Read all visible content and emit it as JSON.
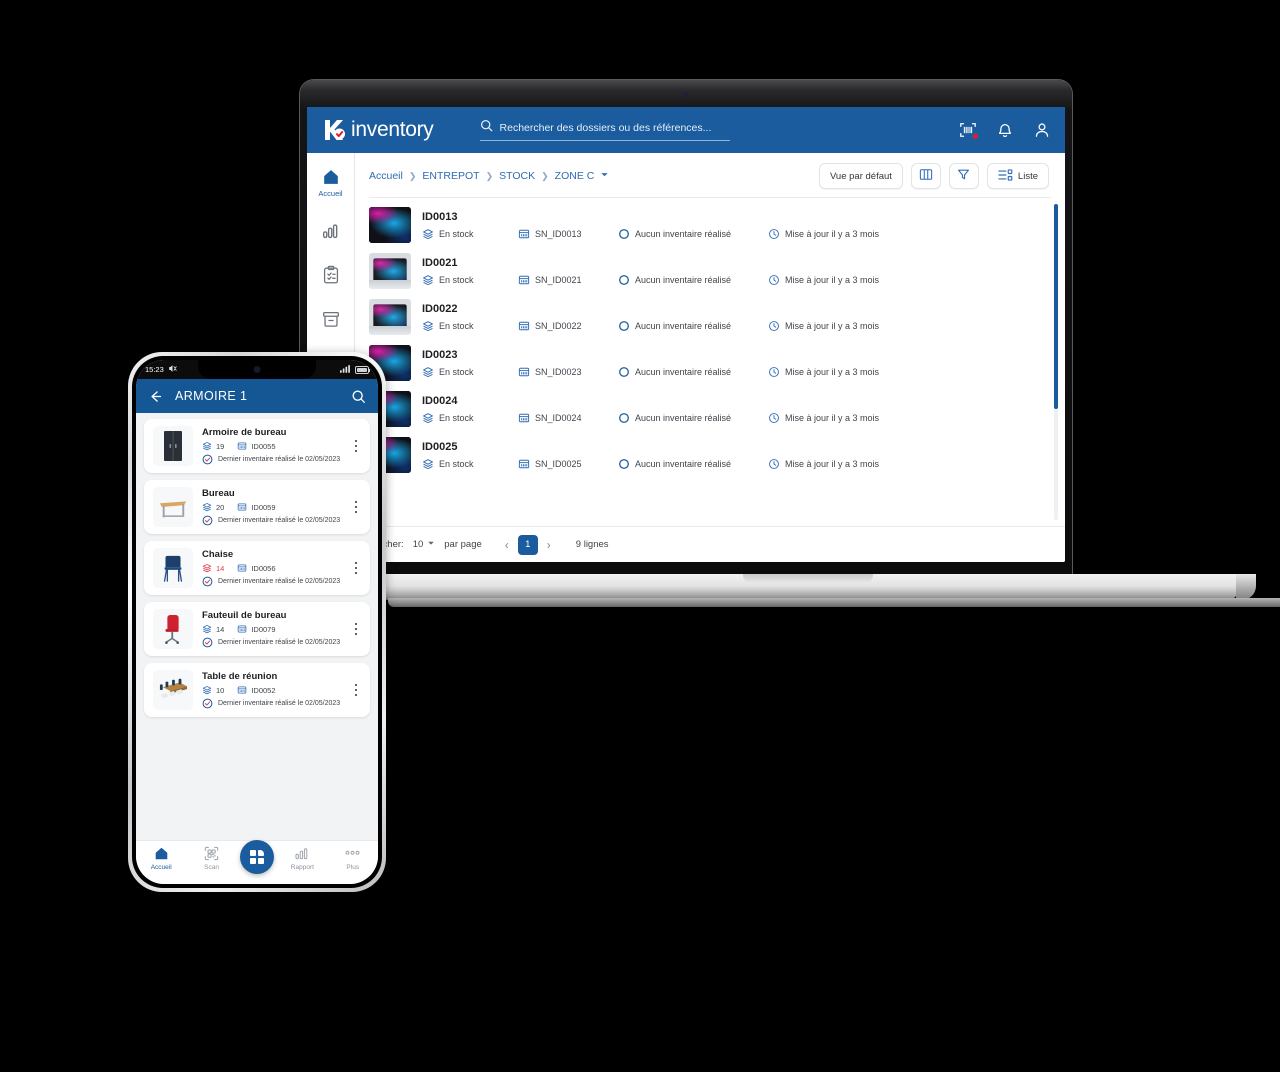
{
  "desktop": {
    "brand": {
      "logo_icon": "k-check-logo",
      "name": "inventory"
    },
    "search": {
      "icon": "search-icon",
      "placeholder": "Rechercher des dossiers ou des références..."
    },
    "header_icons": [
      {
        "name": "barcode-scan-icon",
        "badge": true
      },
      {
        "name": "bell-icon",
        "badge": false
      },
      {
        "name": "user-icon",
        "badge": false
      }
    ],
    "sidebar": [
      {
        "icon": "home-icon",
        "label": "Accueil",
        "active": true
      },
      {
        "icon": "bar-chart-icon",
        "label": "",
        "active": false
      },
      {
        "icon": "clipboard-check-icon",
        "label": "",
        "active": false
      },
      {
        "icon": "archive-box-icon",
        "label": "",
        "active": false
      }
    ],
    "breadcrumb": [
      "Accueil",
      "ENTREPOT",
      "STOCK",
      "ZONE C"
    ],
    "toolbar": {
      "view_label": "Vue par défaut",
      "columns_icon": "columns-icon",
      "filter_icon": "filter-funnel-icon",
      "list_label": "Liste",
      "list_icon": "list-view-icon"
    },
    "rows": [
      {
        "id": "ID0013",
        "status": "En stock",
        "serial": "SN_ID0013",
        "inventory": "Aucun inventaire réalisé",
        "updated": "Mise à jour il y a 3 mois",
        "thumb": "dark"
      },
      {
        "id": "ID0021",
        "status": "En stock",
        "serial": "SN_ID0021",
        "inventory": "Aucun inventaire réalisé",
        "updated": "Mise à jour il y a 3 mois",
        "thumb": "light"
      },
      {
        "id": "ID0022",
        "status": "En stock",
        "serial": "SN_ID0022",
        "inventory": "Aucun inventaire réalisé",
        "updated": "Mise à jour il y a 3 mois",
        "thumb": "light"
      },
      {
        "id": "ID0023",
        "status": "En stock",
        "serial": "SN_ID0023",
        "inventory": "Aucun inventaire réalisé",
        "updated": "Mise à jour il y a 3 mois",
        "thumb": "dark"
      },
      {
        "id": "ID0024",
        "status": "En stock",
        "serial": "SN_ID0024",
        "inventory": "Aucun inventaire réalisé",
        "updated": "Mise à jour il y a 3 mois",
        "thumb": "dark"
      },
      {
        "id": "ID0025",
        "status": "En stock",
        "serial": "SN_ID0025",
        "inventory": "Aucun inventaire réalisé",
        "updated": "Mise à jour il y a 3 mois",
        "thumb": "dark"
      }
    ],
    "footer": {
      "show_label": "Afficher:",
      "page_size": "10",
      "per_page_label": "par page",
      "prev": "‹",
      "current_page": "1",
      "next": "›",
      "total": "9 lignes"
    }
  },
  "phone": {
    "status": {
      "time": "15:23",
      "mute_icon": "mute-icon",
      "signal_icon": "signal-icon",
      "battery_icon": "battery-icon"
    },
    "header": {
      "back_icon": "back-arrow-icon",
      "title": "ARMOIRE 1",
      "search_icon": "search-icon"
    },
    "cards": [
      {
        "name": "Armoire de bureau",
        "count": "19",
        "count_warn": false,
        "ref": "ID0055",
        "note": "Dernier inventaire réalisé le 02/05/2023",
        "img": "cabinet"
      },
      {
        "name": "Bureau",
        "count": "20",
        "count_warn": false,
        "ref": "ID0059",
        "note": "Dernier inventaire réalisé le 02/05/2023",
        "img": "desk"
      },
      {
        "name": "Chaise",
        "count": "14",
        "count_warn": true,
        "ref": "ID0056",
        "note": "Dernier inventaire réalisé le 02/05/2023",
        "img": "chair"
      },
      {
        "name": "Fauteuil de bureau",
        "count": "14",
        "count_warn": false,
        "ref": "ID0079",
        "note": "Dernier inventaire réalisé le 02/05/2023",
        "img": "armchair"
      },
      {
        "name": "Table de réunion",
        "count": "10",
        "count_warn": false,
        "ref": "ID0052",
        "note": "Dernier inventaire réalisé le 02/05/2023",
        "img": "table"
      }
    ],
    "nav": [
      {
        "label": "Accueil",
        "icon": "home-icon",
        "active": true
      },
      {
        "label": "Scan",
        "icon": "qr-scan-icon",
        "active": false
      },
      {
        "label": "",
        "icon": "grid-apps-icon",
        "active": false,
        "fab": true
      },
      {
        "label": "Rapport",
        "icon": "bar-chart-icon",
        "active": false
      },
      {
        "label": "Plus",
        "icon": "more-dots-icon",
        "active": false
      }
    ]
  },
  "colors": {
    "brand_blue": "#1a5c9e",
    "phone_blue": "#155794",
    "accent_red": "#e8192c",
    "warn_red": "#e03a4e"
  }
}
